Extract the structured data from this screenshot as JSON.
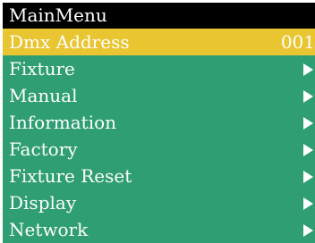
{
  "title": "MainMenu",
  "colors": {
    "title_bg": "#000000",
    "list_bg": "#2f9e72",
    "selected_bg": "#e8c531",
    "text": "#ffffff"
  },
  "menu": {
    "items": [
      {
        "label": "Dmx Address",
        "value": "001",
        "selected": true,
        "icon": ""
      },
      {
        "label": "Fixture",
        "value": "",
        "selected": false,
        "icon": "submenu-arrow-icon"
      },
      {
        "label": "Manual",
        "value": "",
        "selected": false,
        "icon": "submenu-arrow-icon"
      },
      {
        "label": "Information",
        "value": "",
        "selected": false,
        "icon": "submenu-arrow-icon"
      },
      {
        "label": "Factory",
        "value": "",
        "selected": false,
        "icon": "submenu-arrow-icon"
      },
      {
        "label": "Fixture Reset",
        "value": "",
        "selected": false,
        "icon": "submenu-arrow-icon"
      },
      {
        "label": "Display",
        "value": "",
        "selected": false,
        "icon": "submenu-arrow-icon"
      },
      {
        "label": "Network",
        "value": "",
        "selected": false,
        "icon": "submenu-arrow-icon"
      }
    ]
  }
}
